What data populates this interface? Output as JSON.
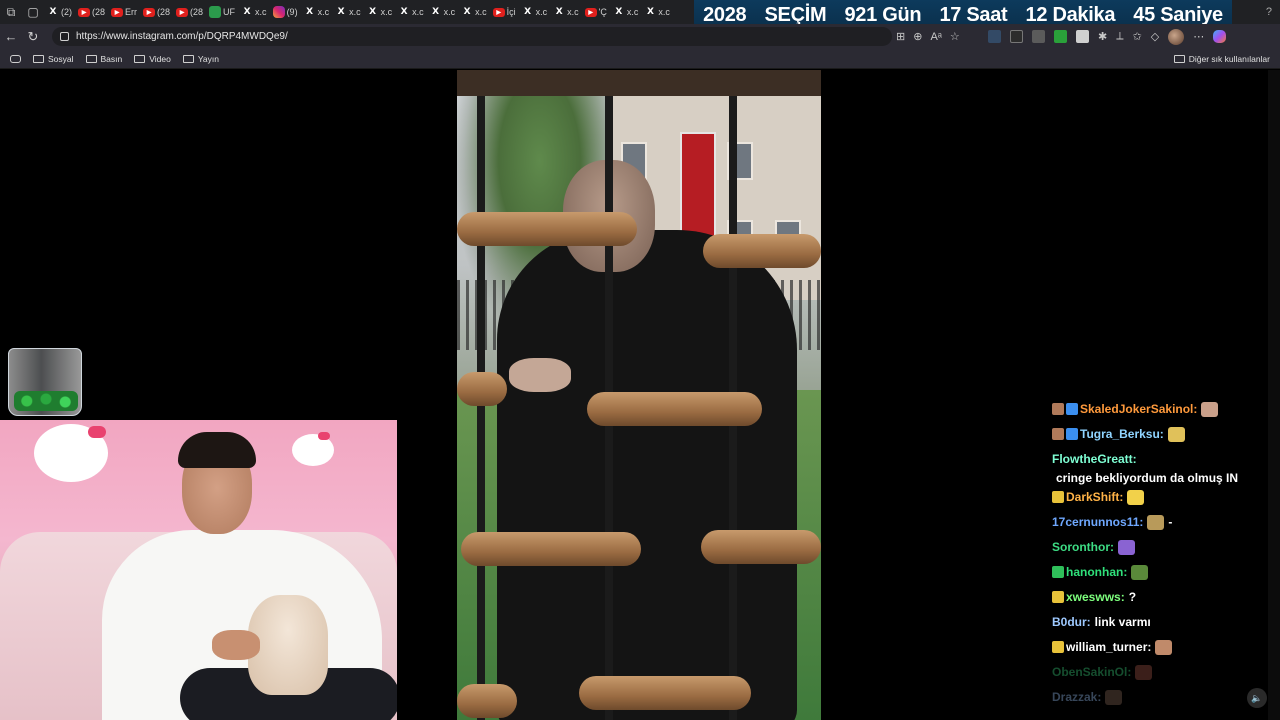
{
  "tabstrip": {
    "tabs": [
      {
        "icon": "x-icon",
        "glyph": "X",
        "label": "(2)"
      },
      {
        "icon": "youtube-icon",
        "glyph": "▶",
        "label": "(28"
      },
      {
        "icon": "youtube-icon",
        "glyph": "▶",
        "label": "Err"
      },
      {
        "icon": "youtube-icon",
        "glyph": "▶",
        "label": "(28"
      },
      {
        "icon": "youtube-icon",
        "glyph": "▶",
        "label": "(28"
      },
      {
        "icon": "green-icon",
        "glyph": "",
        "label": "UF"
      },
      {
        "icon": "x-icon",
        "glyph": "X",
        "label": "x.c"
      },
      {
        "icon": "instagram-icon",
        "glyph": "",
        "label": "(9)"
      },
      {
        "icon": "x-icon",
        "glyph": "X",
        "label": "x.c"
      },
      {
        "icon": "x-icon",
        "glyph": "X",
        "label": "x.c"
      },
      {
        "icon": "x-icon",
        "glyph": "X",
        "label": "x.c"
      },
      {
        "icon": "x-icon",
        "glyph": "X",
        "label": "x.c"
      },
      {
        "icon": "x-icon",
        "glyph": "X",
        "label": "x.c"
      },
      {
        "icon": "x-icon",
        "glyph": "X",
        "label": "x.c"
      },
      {
        "icon": "youtube-icon",
        "glyph": "▶",
        "label": "İçi"
      },
      {
        "icon": "x-icon",
        "glyph": "X",
        "label": "x.c"
      },
      {
        "icon": "x-icon",
        "glyph": "X",
        "label": "x.c"
      },
      {
        "icon": "youtube-icon",
        "glyph": "▶",
        "label": "'Ç"
      },
      {
        "icon": "x-icon",
        "glyph": "X",
        "label": "x.c"
      },
      {
        "icon": "x-icon",
        "glyph": "X",
        "label": "x.c"
      }
    ]
  },
  "countdown": {
    "year": "2028",
    "election": "SEÇİM",
    "days": "921 Gün",
    "hours": "17 Saat",
    "minutes": "12 Dakika",
    "seconds": "45 Saniye"
  },
  "addressbar": {
    "url": "https://www.instagram.com/p/DQRP4MWDQe9/"
  },
  "bookmarks": {
    "items": [
      "Sosyal",
      "Basın",
      "Video",
      "Yayın"
    ],
    "other": "Diğer sık kullanılanlar"
  },
  "chat": {
    "messages": [
      {
        "user": "SkaledJokerSakinol:",
        "color": "#ff9a3c",
        "text": "",
        "badges": [
          "#b07a5a",
          "#3b8ff0"
        ],
        "emote": "#caa08a",
        "faded": false
      },
      {
        "user": "Tugra_Berksu:",
        "color": "#8fd4ff",
        "text": "",
        "badges": [
          "#b07a5a",
          "#3b8ff0"
        ],
        "emote": "#e0c15a",
        "faded": false
      },
      {
        "user": "FlowtheGreatt:",
        "color": "#7fffd4",
        "text": "cringe bekliyordum da olmuş IN",
        "badges": [],
        "emote": "",
        "faded": false
      },
      {
        "user": "DarkShift:",
        "color": "#ffb347",
        "text": "",
        "badges": [
          "#e8c23a"
        ],
        "emote": "#f2d14a",
        "faded": false
      },
      {
        "user": "17cernunnos11:",
        "color": "#6fa8ff",
        "text": "-",
        "badges": [],
        "emote": "#b89a5a",
        "faded": false
      },
      {
        "user": "Soronthor:",
        "color": "#3ddc84",
        "text": "",
        "badges": [],
        "emote": "#8a63d2",
        "faded": false
      },
      {
        "user": "hanonhan:",
        "color": "#2fe07a",
        "text": "",
        "badges": [
          "#2fbf5a"
        ],
        "emote": "#5a8a3a",
        "faded": false
      },
      {
        "user": "xweswws:",
        "color": "#7dff7d",
        "text": "?",
        "badges": [
          "#e8c23a"
        ],
        "emote": "",
        "faded": false
      },
      {
        "user": "B0dur:",
        "color": "#9ec9ff",
        "text": "link varmı",
        "badges": [],
        "emote": "",
        "faded": false
      },
      {
        "user": "william_turner:",
        "color": "#ffffff",
        "text": "",
        "badges": [
          "#e8c23a"
        ],
        "emote": "#c08a6a",
        "faded": false
      },
      {
        "user": "ObenSakinOl:",
        "color": "#3ddc84",
        "text": "",
        "badges": [],
        "emote": "#a85a4a",
        "faded": true
      },
      {
        "user": "Drazzak:",
        "color": "#9ec9ff",
        "text": "",
        "badges": [],
        "emote": "#8a6a5a",
        "faded": true
      }
    ]
  },
  "colors": {
    "countdown_bg": "#0d3a5c",
    "chrome_bg": "#2b2a33"
  }
}
